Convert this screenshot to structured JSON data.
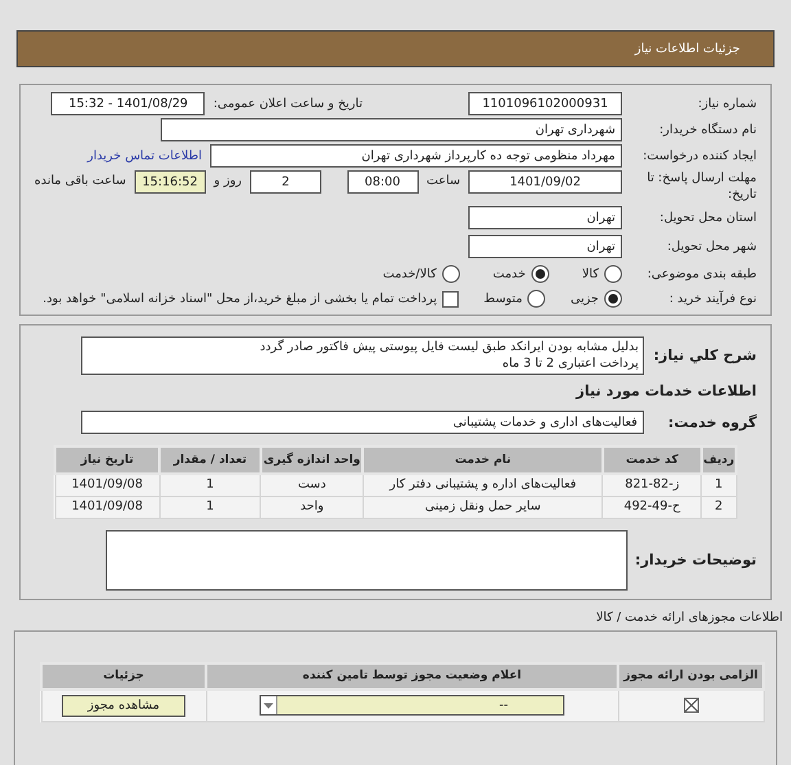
{
  "header": {
    "title": "جزئیات اطلاعات نیاز"
  },
  "details": {
    "need_number": {
      "label": "شماره نیاز:",
      "value": "1101096102000931"
    },
    "announce": {
      "label": "تاریخ و ساعت اعلان عمومی:",
      "value": "1401/08/29 - 15:32"
    },
    "buyer": {
      "label": "نام دستگاه خریدار:",
      "value": "شهرداری تهران"
    },
    "creator": {
      "label": "ایجاد کننده درخواست:",
      "value": "مهرداد منظومی توجه ده کارپرداز شهرداری تهران",
      "link": "اطلاعات تماس خریدار"
    },
    "deadline": {
      "label": "مهلت ارسال پاسخ: تا تاریخ:",
      "date": "1401/09/02",
      "time_label": "ساعت",
      "time": "08:00",
      "days": "2",
      "days_label": "روز و",
      "remaining": "15:16:52",
      "remaining_label": "ساعت باقی مانده"
    },
    "province": {
      "label": "استان محل تحویل:",
      "value": "تهران"
    },
    "city": {
      "label": "شهر محل تحویل:",
      "value": "تهران"
    },
    "category": {
      "label": "طبقه بندی موضوعی:",
      "options": [
        {
          "label": "کالا",
          "selected": false
        },
        {
          "label": "خدمت",
          "selected": true
        },
        {
          "label": "کالا/خدمت",
          "selected": false
        }
      ]
    },
    "process": {
      "label": "نوع فرآیند خرید :",
      "options": [
        {
          "label": "جزیی",
          "selected": true
        },
        {
          "label": "متوسط",
          "selected": false
        }
      ],
      "treasury": {
        "label": "پرداخت تمام یا بخشی از مبلغ خرید،از محل \"اسناد خزانه اسلامی\" خواهد بود.",
        "checked": false
      }
    }
  },
  "needs": {
    "description": {
      "label": "شرح کلي نياز:",
      "lines": [
        "بدلیل مشابه بودن ایرانکد طبق لیست فایل پیوستی پیش فاکتور صادر گردد",
        "پرداخت اعتباری 2 تا 3 ماه"
      ]
    },
    "services_title": "اطلاعات خدمات مورد نیاز",
    "group": {
      "label": "گروه خدمت:",
      "value": "فعالیت‌های اداری و خدمات پشتیبانی"
    },
    "table": {
      "columns": [
        "ردیف",
        "کد خدمت",
        "نام خدمت",
        "واحد اندازه گیری",
        "تعداد / مقدار",
        "تاریخ نیاز"
      ],
      "rows": [
        [
          "1",
          "ز-82-821",
          "فعالیت‌های اداره و پشتیبانی دفتر کار",
          "دست",
          "1",
          "1401/09/08"
        ],
        [
          "2",
          "ح-49-492",
          "سایر حمل ونقل زمینی",
          "واحد",
          "1",
          "1401/09/08"
        ]
      ]
    },
    "buyer_notes": {
      "label": "توضیحات خریدار:"
    }
  },
  "permits": {
    "title": "اطلاعات مجوزهای ارائه خدمت / کالا",
    "columns": [
      "الزامی بودن ارائه مجوز",
      "اعلام وضعیت مجوز توسط تامین کننده",
      "جزئیات"
    ],
    "rows": [
      {
        "required": true,
        "status": "--",
        "button": "مشاهده مجوز"
      }
    ]
  }
}
